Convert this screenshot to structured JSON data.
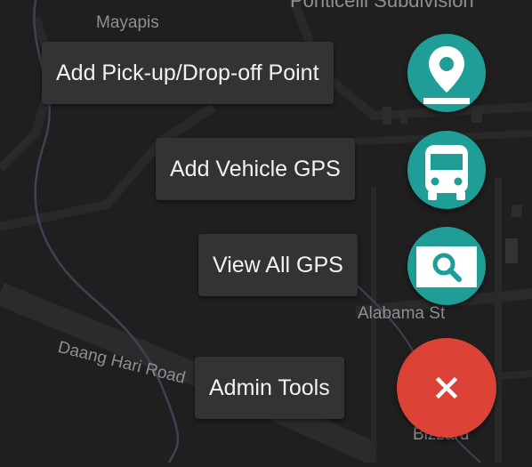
{
  "map": {
    "labels": {
      "mayapis": "Mayapis",
      "subdivision": "Ponticelli Subdivision",
      "alabama": "Alabama St",
      "daang_hari": "Daang Hari Road",
      "bizzard": "Bizzard"
    }
  },
  "speed_dial": {
    "actions": [
      {
        "label": "Add Pick-up/Drop-off Point",
        "icon": "map-pin-icon"
      },
      {
        "label": "Add Vehicle GPS",
        "icon": "bus-icon"
      },
      {
        "label": "View All GPS",
        "icon": "search-icon"
      },
      {
        "label": "Admin Tools",
        "icon": "close-icon"
      }
    ],
    "colors": {
      "mini_fab": "#1e9e96",
      "main_fab": "#dd4237",
      "label_bg": "#333333"
    }
  }
}
